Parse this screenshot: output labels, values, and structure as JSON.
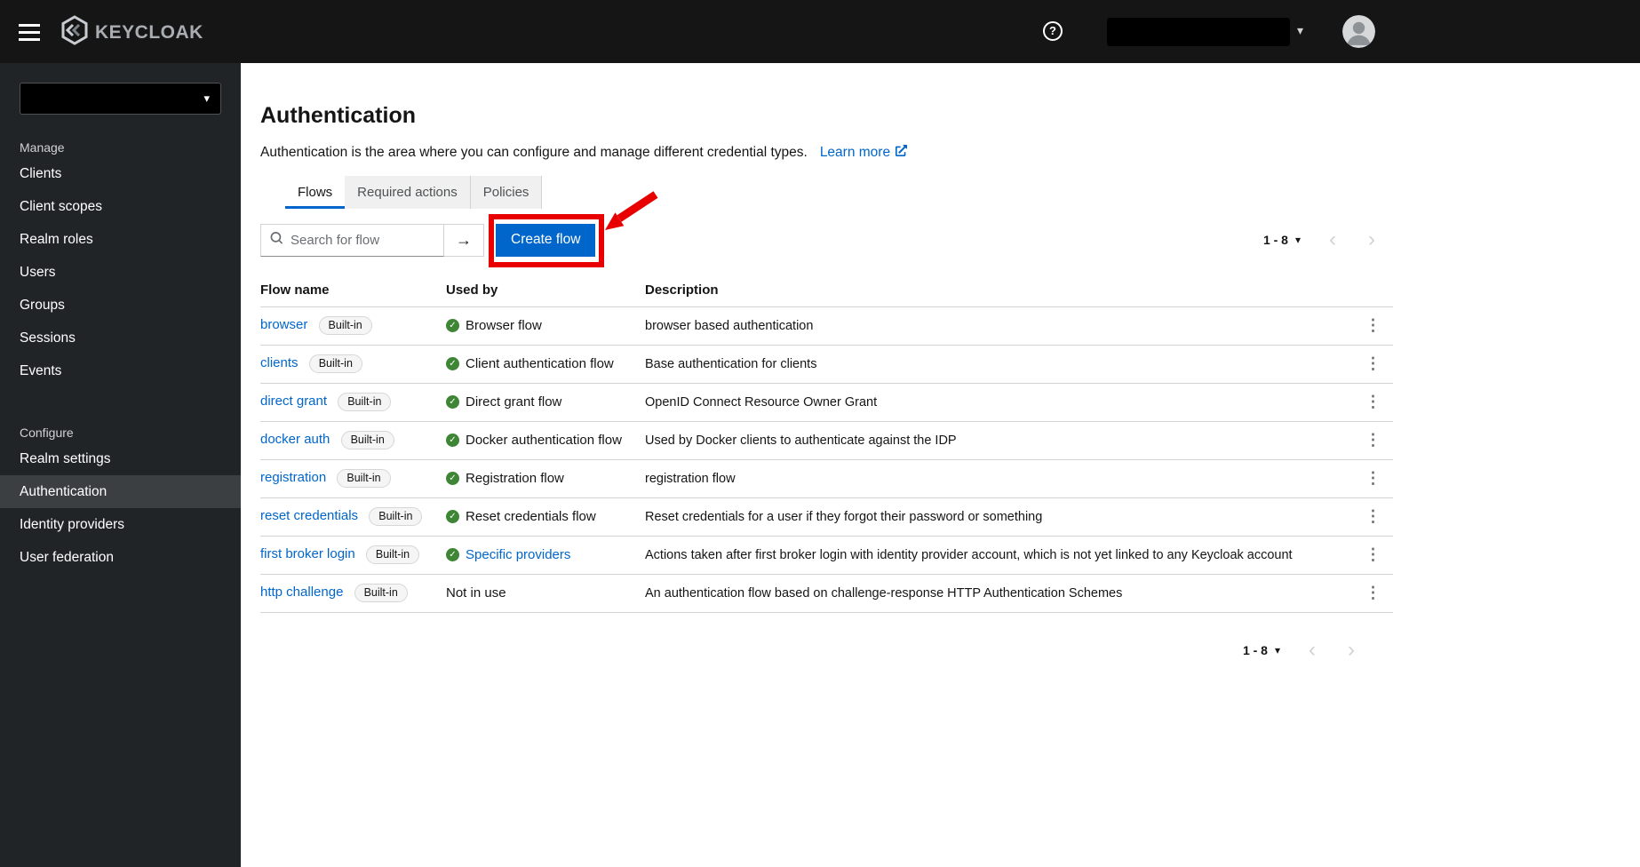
{
  "colors": {
    "accent": "#0066cc",
    "masthead_bg": "#151515",
    "sidebar_bg": "#212427",
    "success_green": "#3e8635",
    "annotation_red": "#e80000"
  },
  "icons": {
    "kebab": "⋮",
    "caret_down": "▾",
    "chevron_left": "‹",
    "chevron_right": "›",
    "arrow_right": "→",
    "check": "✓",
    "help": "?"
  },
  "topbar": {
    "brand": "KEYCLOAK"
  },
  "sidebar": {
    "manage_label": "Manage",
    "manage_items": [
      {
        "label": "Clients"
      },
      {
        "label": "Client scopes"
      },
      {
        "label": "Realm roles"
      },
      {
        "label": "Users"
      },
      {
        "label": "Groups"
      },
      {
        "label": "Sessions"
      },
      {
        "label": "Events"
      }
    ],
    "configure_label": "Configure",
    "configure_items": [
      {
        "label": "Realm settings"
      },
      {
        "label": "Authentication",
        "active": true
      },
      {
        "label": "Identity providers"
      },
      {
        "label": "User federation"
      }
    ]
  },
  "header": {
    "title": "Authentication",
    "subtitle": "Authentication is the area where you can configure and manage different credential types.",
    "learn_more": "Learn more"
  },
  "tabs": [
    {
      "label": "Flows",
      "active": true
    },
    {
      "label": "Required actions",
      "active": false
    },
    {
      "label": "Policies",
      "active": false
    }
  ],
  "toolbar": {
    "search_placeholder": "Search for flow",
    "create_button": "Create flow",
    "pagination_range": "1 - 8"
  },
  "table": {
    "columns": [
      "Flow name",
      "Used by",
      "Description"
    ],
    "rows": [
      {
        "name": "browser",
        "badge": "Built-in",
        "used_by": "Browser flow",
        "description": "browser based authentication"
      },
      {
        "name": "clients",
        "badge": "Built-in",
        "used_by": "Client authentication flow",
        "description": "Base authentication for clients"
      },
      {
        "name": "direct grant",
        "badge": "Built-in",
        "used_by": "Direct grant flow",
        "description": "OpenID Connect Resource Owner Grant"
      },
      {
        "name": "docker auth",
        "badge": "Built-in",
        "used_by": "Docker authentication flow",
        "description": "Used by Docker clients to authenticate against the IDP"
      },
      {
        "name": "registration",
        "badge": "Built-in",
        "used_by": "Registration flow",
        "description": "registration flow"
      },
      {
        "name": "reset credentials",
        "badge": "Built-in",
        "used_by": "Reset credentials flow",
        "description": "Reset credentials for a user if they forgot their password or something"
      },
      {
        "name": "first broker login",
        "badge": "Built-in",
        "used_by": "Specific providers",
        "used_by_link": true,
        "description": "Actions taken after first broker login with identity provider account, which is not yet linked to any Keycloak account"
      },
      {
        "name": "http challenge",
        "badge": "Built-in",
        "used_by": "Not in use",
        "no_icon": true,
        "description": "An authentication flow based on challenge-response HTTP Authentication Schemes"
      }
    ]
  },
  "footer": {
    "pagination_range": "1 - 8"
  }
}
